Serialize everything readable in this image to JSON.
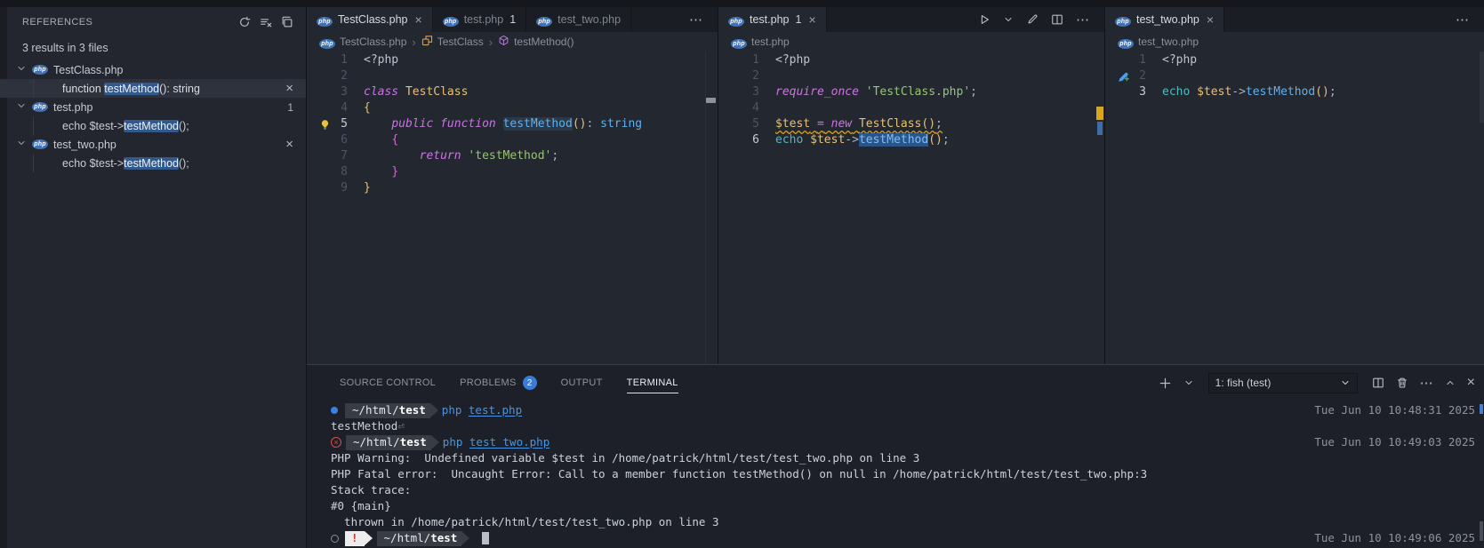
{
  "sidebar": {
    "title": "REFERENCES",
    "actions": [
      {
        "icon": "refresh-icon"
      },
      {
        "icon": "clear-all-icon"
      },
      {
        "icon": "open-editors-icon"
      }
    ],
    "summary": "3 results in 3 files",
    "files": [
      {
        "name": "TestClass.php",
        "refs": [
          {
            "pre": "function ",
            "match": "testMethod",
            "post": "(): string",
            "selected": true,
            "close": true
          }
        ]
      },
      {
        "name": "test.php",
        "badge": "1",
        "refs": [
          {
            "pre": "echo $test->",
            "match": "testMethod",
            "post": "();"
          }
        ]
      },
      {
        "name": "test_two.php",
        "close": true,
        "refs": [
          {
            "pre": "echo $test->",
            "match": "testMethod",
            "post": "();"
          }
        ]
      }
    ]
  },
  "editor_groups": [
    {
      "tabs": [
        {
          "label": "TestClass.php",
          "active": true,
          "close": true
        },
        {
          "label": "test.php",
          "badge": "1"
        },
        {
          "label": "test_two.php"
        }
      ],
      "overflow": true,
      "breadcrumbs": [
        {
          "icon": "php-icon",
          "label": "TestClass.php"
        },
        {
          "icon": "class-icon",
          "label": "TestClass"
        },
        {
          "icon": "method-icon",
          "label": "testMethod()"
        }
      ],
      "code": [
        {
          "n": "1",
          "tokens": [
            [
              "meta",
              "<?php"
            ]
          ]
        },
        {
          "n": "2",
          "tokens": []
        },
        {
          "n": "3",
          "tokens": [
            [
              "kw",
              "class"
            ],
            [
              "plain",
              " "
            ],
            [
              "cls",
              "TestClass"
            ]
          ]
        },
        {
          "n": "4",
          "tokens": [
            [
              "b1",
              "{"
            ]
          ]
        },
        {
          "n": "5",
          "current": true,
          "lightbulb": true,
          "tokens": [
            [
              "plain",
              "    "
            ],
            [
              "kw",
              "public"
            ],
            [
              "plain",
              " "
            ],
            [
              "kw",
              "function"
            ],
            [
              "plain",
              " "
            ],
            [
              "fnhl",
              "testMethod"
            ],
            [
              "b1",
              "()"
            ],
            [
              "plain",
              ": "
            ],
            [
              "type",
              "string"
            ]
          ]
        },
        {
          "n": "6",
          "tokens": [
            [
              "plain",
              "    "
            ],
            [
              "b2",
              "{"
            ]
          ]
        },
        {
          "n": "7",
          "tokens": [
            [
              "plain",
              "        "
            ],
            [
              "kw",
              "return"
            ],
            [
              "plain",
              " "
            ],
            [
              "str",
              "'testMethod'"
            ],
            [
              "plain",
              ";"
            ]
          ]
        },
        {
          "n": "8",
          "tokens": [
            [
              "plain",
              "    "
            ],
            [
              "b2",
              "}"
            ]
          ]
        },
        {
          "n": "9",
          "tokens": [
            [
              "b1",
              "}"
            ]
          ]
        }
      ]
    },
    {
      "tabs": [
        {
          "label": "test.php",
          "badge": "1",
          "active": true,
          "close": true
        }
      ],
      "actions": [
        {
          "icon": "run-icon"
        },
        {
          "icon": "chevron-down-icon"
        },
        {
          "icon": "pencil-icon"
        },
        {
          "icon": "split-editor-icon"
        },
        {
          "icon": "more-icon"
        }
      ],
      "breadcrumbs": [
        {
          "icon": "php-icon",
          "label": "test.php"
        }
      ],
      "code": [
        {
          "n": "1",
          "tokens": [
            [
              "meta",
              "<?php"
            ]
          ]
        },
        {
          "n": "2",
          "tokens": []
        },
        {
          "n": "3",
          "tokens": [
            [
              "kw",
              "require_once"
            ],
            [
              "plain",
              " "
            ],
            [
              "str",
              "'TestClass.php'"
            ],
            [
              "plain",
              ";"
            ]
          ]
        },
        {
          "n": "4",
          "tokens": []
        },
        {
          "n": "5",
          "squiggle": true,
          "tokens": [
            [
              "var",
              "$test"
            ],
            [
              "plain",
              " "
            ],
            [
              "op",
              "="
            ],
            [
              "plain",
              " "
            ],
            [
              "kw",
              "new"
            ],
            [
              "plain",
              " "
            ],
            [
              "cls",
              "TestClass"
            ],
            [
              "b1",
              "()"
            ],
            [
              "plain",
              ";"
            ]
          ]
        },
        {
          "n": "6",
          "current": true,
          "tokens": [
            [
              "echo",
              "echo"
            ],
            [
              "plain",
              " "
            ],
            [
              "var",
              "$test"
            ],
            [
              "plain",
              "->"
            ],
            [
              "selfn",
              "testMethod"
            ],
            [
              "b1",
              "()"
            ],
            [
              "plain",
              ";"
            ]
          ]
        }
      ]
    },
    {
      "tabs": [
        {
          "label": "test_two.php",
          "active": true,
          "close": true
        }
      ],
      "actions": [
        {
          "icon": "more-icon"
        }
      ],
      "breadcrumbs": [
        {
          "icon": "php-icon",
          "label": "test_two.php"
        }
      ],
      "code": [
        {
          "n": "1",
          "tokens": [
            [
              "meta",
              "<?php"
            ]
          ]
        },
        {
          "n": "2",
          "copilot": true,
          "tokens": []
        },
        {
          "n": "3",
          "current": true,
          "tokens": [
            [
              "echo",
              "echo"
            ],
            [
              "plain",
              " "
            ],
            [
              "var",
              "$test"
            ],
            [
              "plain",
              "->"
            ],
            [
              "fn",
              "testMethod"
            ],
            [
              "b1",
              "()"
            ],
            [
              "plain",
              ";"
            ]
          ]
        }
      ]
    }
  ],
  "panel": {
    "tabs": [
      {
        "label": "SOURCE CONTROL"
      },
      {
        "label": "PROBLEMS",
        "badge": "2"
      },
      {
        "label": "OUTPUT"
      },
      {
        "label": "TERMINAL",
        "active": true
      }
    ],
    "new_terminal_actions": [
      {
        "icon": "plus-icon"
      },
      {
        "icon": "chevron-down-icon"
      }
    ],
    "terminal_select": "1: fish (test)",
    "actions": [
      {
        "icon": "split-terminal-icon"
      },
      {
        "icon": "trash-icon"
      },
      {
        "icon": "more-icon"
      },
      {
        "icon": "chevron-up-icon"
      },
      {
        "icon": "close-icon"
      }
    ]
  },
  "terminal": {
    "lines": [
      {
        "type": "prompt",
        "status": "ok",
        "path_head": "~/html/",
        "path_tail": "test",
        "command": "php ",
        "arg": "test.php",
        "timestamp": "Tue Jun 10 10:48:31 2025"
      },
      {
        "type": "output",
        "text": "testMethod",
        "newline_marker": "⏎"
      },
      {
        "type": "prompt",
        "status": "error",
        "path_head": "~/html/",
        "path_tail": "test",
        "command": "php ",
        "arg": "test_two.php",
        "timestamp": "Tue Jun 10 10:49:03 2025"
      },
      {
        "type": "output",
        "text": "PHP Warning:  Undefined variable $test in /home/patrick/html/test/test_two.php on line 3"
      },
      {
        "type": "output",
        "text": "PHP Fatal error:  Uncaught Error: Call to a member function testMethod() on null in /home/patrick/html/test/test_two.php:3"
      },
      {
        "type": "output",
        "text": "Stack trace:"
      },
      {
        "type": "output",
        "text": "#0 {main}"
      },
      {
        "type": "output",
        "text": "  thrown in /home/patrick/html/test/test_two.php on line 3"
      },
      {
        "type": "prompt-current",
        "status_symbol": "!",
        "path_head": "~/html/",
        "path_tail": "test",
        "cursor": true,
        "timestamp": "Tue Jun 10 10:49:06 2025"
      }
    ]
  }
}
